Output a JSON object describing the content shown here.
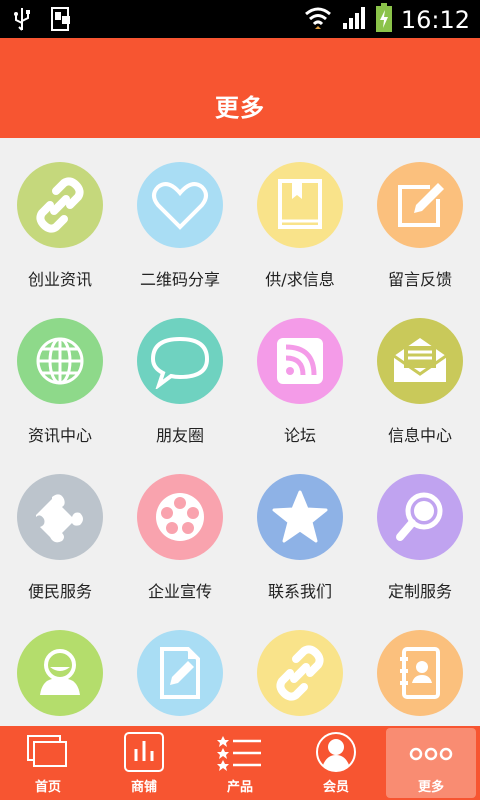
{
  "status_bar": {
    "time": "16:12"
  },
  "header": {
    "title": "更多"
  },
  "grid": {
    "items": [
      {
        "label": "创业资讯",
        "color": "#c5d87c",
        "icon": "link-icon"
      },
      {
        "label": "二维码分享",
        "color": "#a9ddf4",
        "icon": "heart-icon"
      },
      {
        "label": "供/求信息",
        "color": "#f9e38a",
        "icon": "book-icon"
      },
      {
        "label": "留言反馈",
        "color": "#fbc07d",
        "icon": "edit-icon"
      },
      {
        "label": "资讯中心",
        "color": "#8ed98a",
        "icon": "globe-icon"
      },
      {
        "label": "朋友圈",
        "color": "#6fd2c0",
        "icon": "chat-bubble-icon"
      },
      {
        "label": "论坛",
        "color": "#f49be8",
        "icon": "rss-icon"
      },
      {
        "label": "信息中心",
        "color": "#c9c95a",
        "icon": "envelope-icon"
      },
      {
        "label": "便民服务",
        "color": "#bcc4cc",
        "icon": "puzzle-icon"
      },
      {
        "label": "企业宣传",
        "color": "#f9a3ae",
        "icon": "film-reel-icon"
      },
      {
        "label": "联系我们",
        "color": "#8eb2e6",
        "icon": "star-icon"
      },
      {
        "label": "定制服务",
        "color": "#c0a3f0",
        "icon": "magnifier-icon"
      },
      {
        "label": "",
        "color": "#b4dd6c",
        "icon": "user-icon"
      },
      {
        "label": "",
        "color": "#a9ddf4",
        "icon": "document-edit-icon"
      },
      {
        "label": "",
        "color": "#f9e38a",
        "icon": "link-icon"
      },
      {
        "label": "",
        "color": "#fbc07d",
        "icon": "contacts-icon"
      }
    ]
  },
  "tabbar": {
    "tabs": [
      {
        "label": "首页",
        "icon": "home-windows-icon"
      },
      {
        "label": "商铺",
        "icon": "shop-chart-icon"
      },
      {
        "label": "产品",
        "icon": "product-list-icon"
      },
      {
        "label": "会员",
        "icon": "member-icon"
      },
      {
        "label": "更多",
        "icon": "more-dots-icon"
      }
    ],
    "active_index": 4
  }
}
